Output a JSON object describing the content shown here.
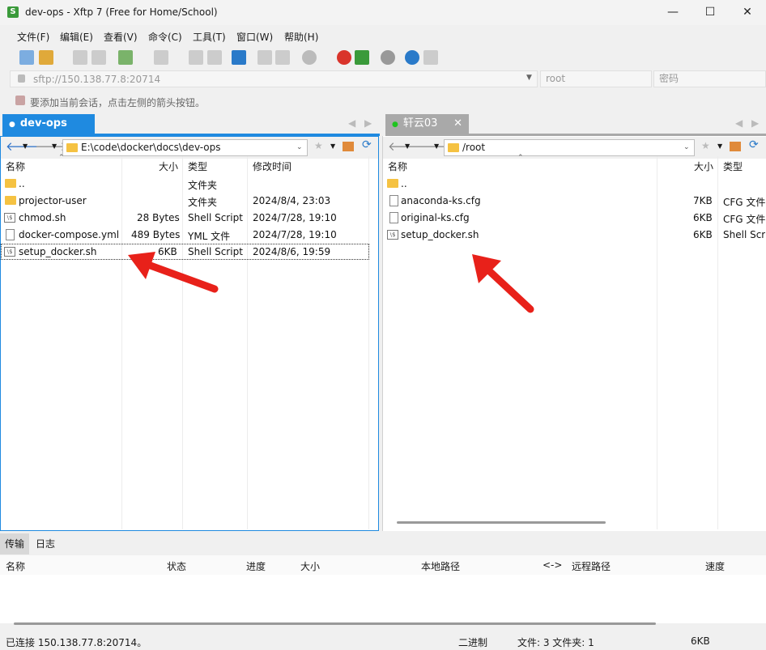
{
  "window": {
    "title": "dev-ops - Xftp 7 (Free for Home/School)",
    "minimize": "—",
    "maximize": "☐",
    "close": "✕"
  },
  "menu": [
    "文件(F)",
    "编辑(E)",
    "查看(V)",
    "命令(C)",
    "工具(T)",
    "窗口(W)",
    "帮助(H)"
  ],
  "address": {
    "url": "sftp://150.138.77.8:20714",
    "username_placeholder": "root",
    "password_placeholder": "密码"
  },
  "hint": "要添加当前会话，点击左侧的箭头按钮。",
  "tabs": {
    "left": "dev-ops",
    "right": "轩云03"
  },
  "left_pane": {
    "path": "E:\\code\\docker\\docs\\dev-ops",
    "headers": {
      "name": "名称",
      "size": "大小",
      "type": "类型",
      "modified": "修改时间"
    },
    "rows": [
      {
        "name": "..",
        "size": "",
        "type": "文件夹",
        "modified": "",
        "icon": "folder"
      },
      {
        "name": "projector-user",
        "size": "",
        "type": "文件夹",
        "modified": "2024/8/4, 23:03",
        "icon": "folder"
      },
      {
        "name": "chmod.sh",
        "size": "28 Bytes",
        "type": "Shell Script",
        "modified": "2024/7/28, 19:10",
        "icon": "script"
      },
      {
        "name": "docker-compose.yml",
        "size": "489 Bytes",
        "type": "YML 文件",
        "modified": "2024/7/28, 19:10",
        "icon": "file"
      },
      {
        "name": "setup_docker.sh",
        "size": "6KB",
        "type": "Shell Script",
        "modified": "2024/8/6, 19:59",
        "icon": "script"
      }
    ]
  },
  "right_pane": {
    "path": "/root",
    "headers": {
      "name": "名称",
      "size": "大小",
      "type": "类型"
    },
    "rows": [
      {
        "name": "..",
        "size": "",
        "type": "",
        "icon": "folder"
      },
      {
        "name": "anaconda-ks.cfg",
        "size": "7KB",
        "type": "CFG 文件",
        "icon": "file"
      },
      {
        "name": "original-ks.cfg",
        "size": "6KB",
        "type": "CFG 文件",
        "icon": "file"
      },
      {
        "name": "setup_docker.sh",
        "size": "6KB",
        "type": "Shell Scri",
        "icon": "script"
      }
    ]
  },
  "bottom": {
    "tabs": [
      "传输",
      "日志"
    ],
    "headers": [
      "名称",
      "状态",
      "进度",
      "大小",
      "本地路径",
      "<->",
      "远程路径",
      "速度"
    ]
  },
  "status": {
    "connection": "已连接 150.138.77.8:20714。",
    "mode": "二进制",
    "counts": "文件: 3  文件夹: 1",
    "size": "6KB"
  },
  "colors": {
    "active_tab": "#1f8ae0",
    "inactive_tab": "#a9a9a9",
    "annotation_arrow": "#e8211a",
    "folder": "#f5c242"
  }
}
